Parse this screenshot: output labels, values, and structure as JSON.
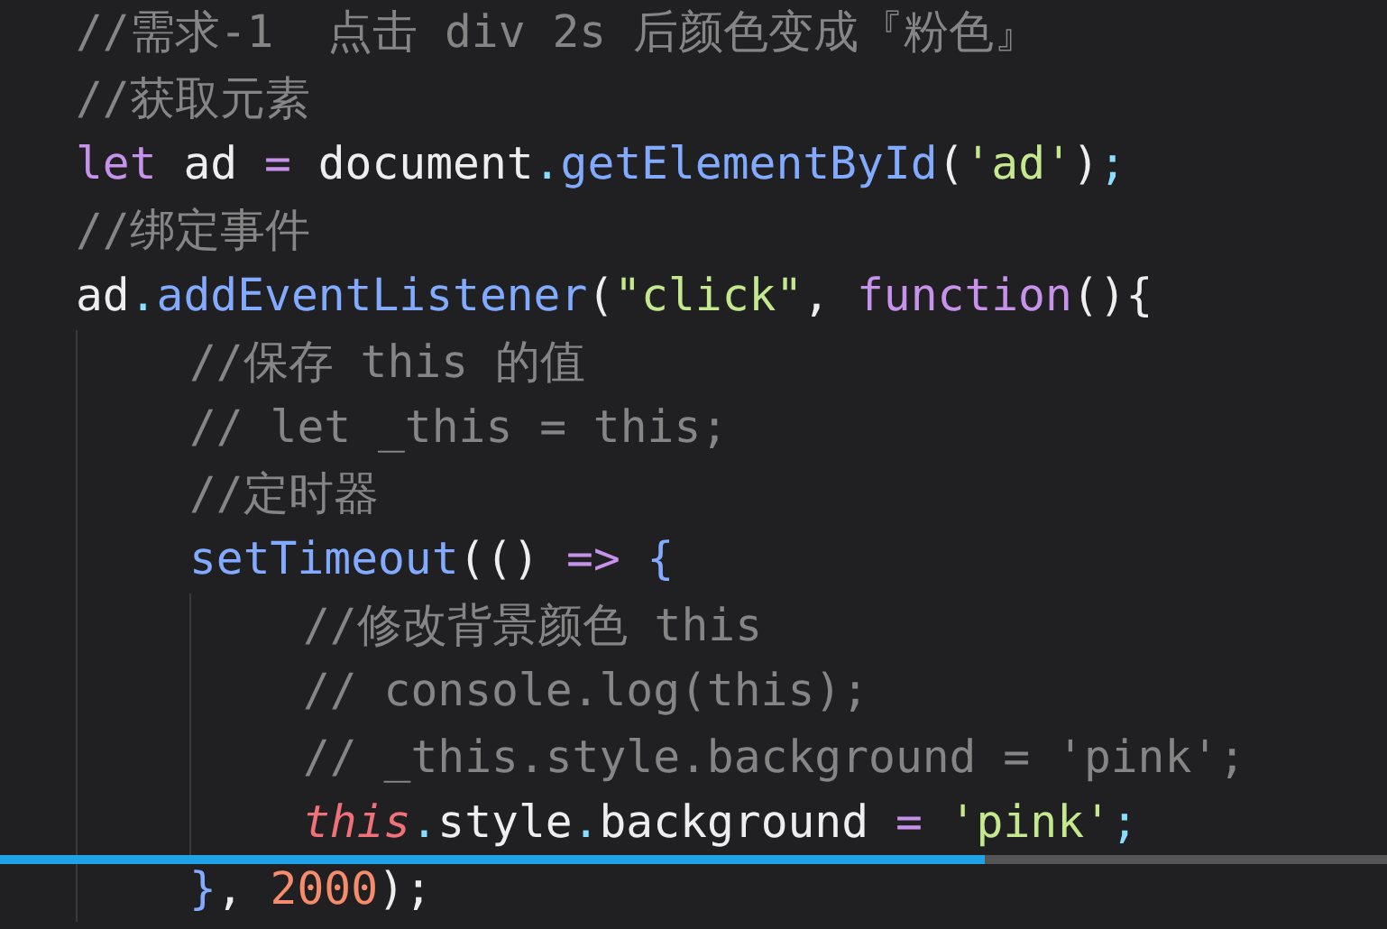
{
  "editor": {
    "lines": [
      {
        "tokens": [
          {
            "kind": "comment",
            "text": "//需求-1  点击 div 2s 后颜色变成『粉色』"
          }
        ]
      },
      {
        "tokens": [
          {
            "kind": "comment",
            "text": "//获取元素"
          }
        ]
      },
      {
        "tokens": [
          {
            "kind": "keyword",
            "text": "let"
          },
          {
            "kind": "plain",
            "text": " ad "
          },
          {
            "kind": "operator",
            "text": "="
          },
          {
            "kind": "plain",
            "text": " document"
          },
          {
            "kind": "punct",
            "text": "."
          },
          {
            "kind": "method",
            "text": "getElementById"
          },
          {
            "kind": "plain",
            "text": "("
          },
          {
            "kind": "string",
            "text": "'ad'"
          },
          {
            "kind": "plain",
            "text": ")"
          },
          {
            "kind": "punct",
            "text": ";"
          }
        ]
      },
      {
        "tokens": [
          {
            "kind": "comment",
            "text": "//绑定事件"
          }
        ]
      },
      {
        "tokens": [
          {
            "kind": "plain",
            "text": "ad"
          },
          {
            "kind": "punct",
            "text": "."
          },
          {
            "kind": "method",
            "text": "addEventListener"
          },
          {
            "kind": "plain",
            "text": "("
          },
          {
            "kind": "string",
            "text": "\"click\""
          },
          {
            "kind": "plain",
            "text": ", "
          },
          {
            "kind": "keyword",
            "text": "function"
          },
          {
            "kind": "plain",
            "text": "(){"
          }
        ],
        "children": [
          {
            "tokens": [
              {
                "kind": "comment",
                "text": "//保存 this 的值"
              }
            ]
          },
          {
            "tokens": [
              {
                "kind": "comment",
                "text": "// let _this = this;"
              }
            ]
          },
          {
            "tokens": [
              {
                "kind": "comment",
                "text": "//定时器"
              }
            ]
          },
          {
            "tokens": [
              {
                "kind": "method",
                "text": "setTimeout"
              },
              {
                "kind": "plain",
                "text": "(() "
              },
              {
                "kind": "keyword",
                "text": "=>"
              },
              {
                "kind": "brace",
                "text": " {"
              }
            ],
            "children": [
              {
                "tokens": [
                  {
                    "kind": "comment",
                    "text": "//修改背景颜色 this"
                  }
                ]
              },
              {
                "tokens": [
                  {
                    "kind": "comment",
                    "text": "// console.log(this);"
                  }
                ]
              },
              {
                "tokens": [
                  {
                    "kind": "comment",
                    "text": "// _this.style.background = 'pink';"
                  }
                ]
              },
              {
                "tokens": [
                  {
                    "kind": "this",
                    "text": "this"
                  },
                  {
                    "kind": "punct",
                    "text": "."
                  },
                  {
                    "kind": "plain",
                    "text": "style"
                  },
                  {
                    "kind": "punct",
                    "text": "."
                  },
                  {
                    "kind": "plain",
                    "text": "background "
                  },
                  {
                    "kind": "operator",
                    "text": "="
                  },
                  {
                    "kind": "string",
                    "text": " 'pink'"
                  },
                  {
                    "kind": "punct",
                    "text": ";"
                  }
                ]
              }
            ]
          },
          {
            "tokens": [
              {
                "kind": "brace",
                "text": "}"
              },
              {
                "kind": "plain",
                "text": ", "
              },
              {
                "kind": "number",
                "text": "2000"
              },
              {
                "kind": "plain",
                "text": ");"
              }
            ]
          }
        ]
      }
    ]
  },
  "player": {
    "progress": {
      "level": 0.71
    }
  }
}
